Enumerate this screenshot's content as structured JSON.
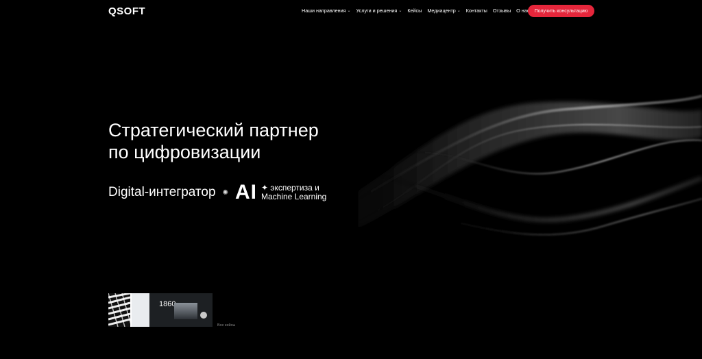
{
  "header": {
    "logo": "QSOFT",
    "nav": [
      {
        "label": "Наши направления",
        "has_dropdown": true
      },
      {
        "label": "Услуги и решения",
        "has_dropdown": true
      },
      {
        "label": "Кейсы",
        "has_dropdown": false
      },
      {
        "label": "Медиацентр",
        "has_dropdown": true
      },
      {
        "label": "Контакты",
        "has_dropdown": false
      },
      {
        "label": "Отзывы",
        "has_dropdown": false
      },
      {
        "label": "О нас",
        "has_dropdown": false
      }
    ],
    "cta_label": "Получить консультацию",
    "dropdown_icon": "chevron-down-icon"
  },
  "hero": {
    "title_line1": "Стратегический партнер",
    "title_line2": "по цифровизации",
    "digital": "Digital-интегратор",
    "ai": "AI",
    "ml_line1": "✦ экспертиза и",
    "ml_line2": "Machine Learning"
  },
  "cases": {
    "case2_year": "1860",
    "all_cases_label": "Все кейсы"
  },
  "colors": {
    "background": "#000000",
    "accent": "#e5263b",
    "text": "#ffffff"
  }
}
